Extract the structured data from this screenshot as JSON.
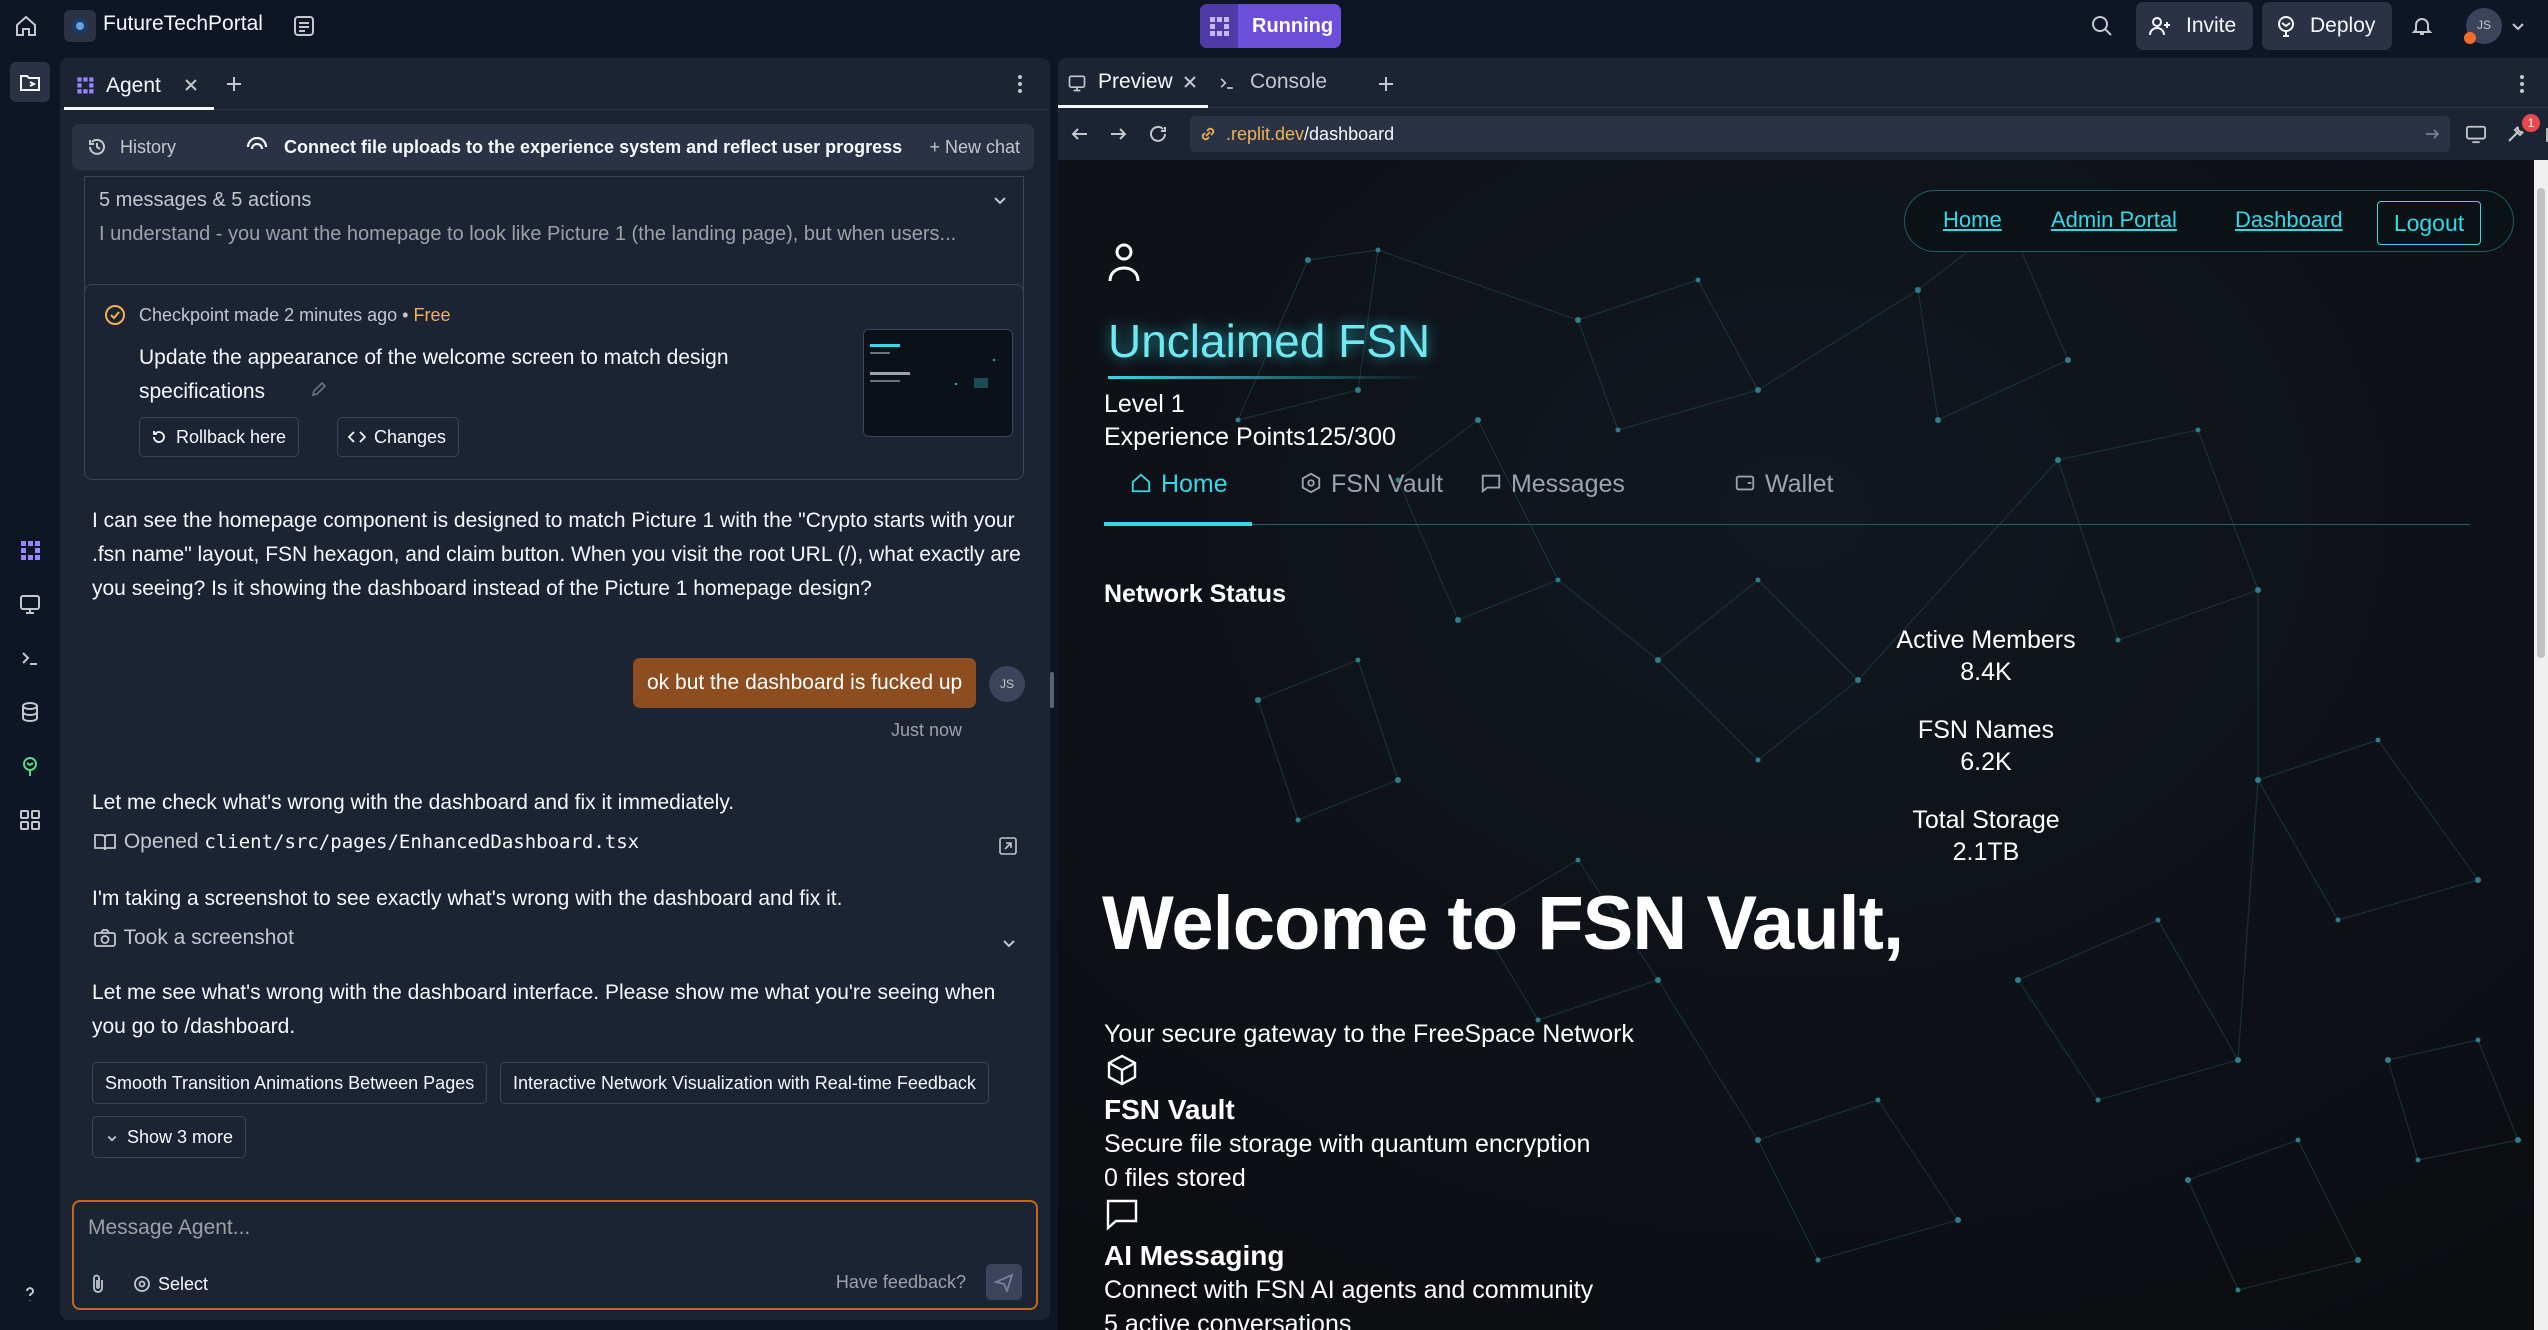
{
  "topbar": {
    "project_name": "FutureTechPortal",
    "run_label": "Running",
    "invite_label": "Invite",
    "deploy_label": "Deploy",
    "avatar_initials": "JS"
  },
  "agent": {
    "tab_label": "Agent",
    "history_label": "History",
    "chat_title": "Connect file uploads to the experience system and reflect user progress",
    "new_chat_label": "New chat",
    "summary_count": "5 messages & 5 actions",
    "summary_preview": "I understand - you want the homepage to look like Picture 1 (the landing page), but when users...",
    "checkpoint": {
      "meta": "Checkpoint made 2 minutes ago",
      "badge": "Free",
      "description": "Update the appearance of the welcome screen to match design specifications",
      "rollback_label": "Rollback here",
      "changes_label": "Changes"
    },
    "msg1": "I can see the homepage component is designed to match Picture 1 with the \"Crypto starts with your .fsn name\" layout, FSN hexagon, and claim button. When you visit the root URL (/), what exactly are you seeing? Is it showing the dashboard instead of the Picture 1 homepage design?",
    "user_msg": "ok but the dashboard is fucked up",
    "user_initials": "JS",
    "user_time": "Just now",
    "msg2": "Let me check what's wrong with the dashboard and fix it immediately.",
    "opened_label": "Opened",
    "opened_file": "client/src/pages/EnhancedDashboard.tsx",
    "msg3": "I'm taking a screenshot to see exactly what's wrong with the dashboard and fix it.",
    "screenshot_label": "Took a screenshot",
    "msg4": "Let me see what's wrong with the dashboard interface. Please show me what you're seeing when you go to /dashboard.",
    "chips": [
      "Smooth Transition Animations Between Pages",
      "Interactive Network Visualization with Real-time Feedback"
    ],
    "show_more": "Show 3 more",
    "composer_placeholder": "Message Agent...",
    "select_label": "Select",
    "feedback_label": "Have feedback?"
  },
  "preview": {
    "tab_preview": "Preview",
    "tab_console": "Console",
    "url_domain": ".replit.dev",
    "url_path": "/dashboard",
    "badge_count": "1"
  },
  "site": {
    "nav": [
      "Home",
      "Admin Portal",
      "Dashboard"
    ],
    "logout": "Logout",
    "title": "Unclaimed FSN",
    "level": "Level 1",
    "xp": "Experience Points125/300",
    "tabs": [
      "Home",
      "FSN Vault",
      "Messages",
      "Wallet"
    ],
    "network_status": "Network Status",
    "stats": [
      {
        "label": "Active Members",
        "value": "8.4K"
      },
      {
        "label": "FSN Names",
        "value": "6.2K"
      },
      {
        "label": "Total Storage",
        "value": "2.1TB"
      }
    ],
    "welcome": "Welcome to FSN Vault,",
    "gateway": "Your secure gateway to the FreeSpace Network",
    "vault_title": "FSN Vault",
    "vault_desc": "Secure file storage with quantum encryption",
    "vault_count": "0 files stored",
    "msg_title": "AI Messaging",
    "msg_desc": "Connect with FSN AI agents and community",
    "msg_count": "5 active conversations"
  },
  "colors": {
    "accent_cyan": "#34d8e8",
    "run_purple": "#6b4fd8",
    "user_bubble": "#8c4e20",
    "composer_border": "#c06a1e"
  }
}
